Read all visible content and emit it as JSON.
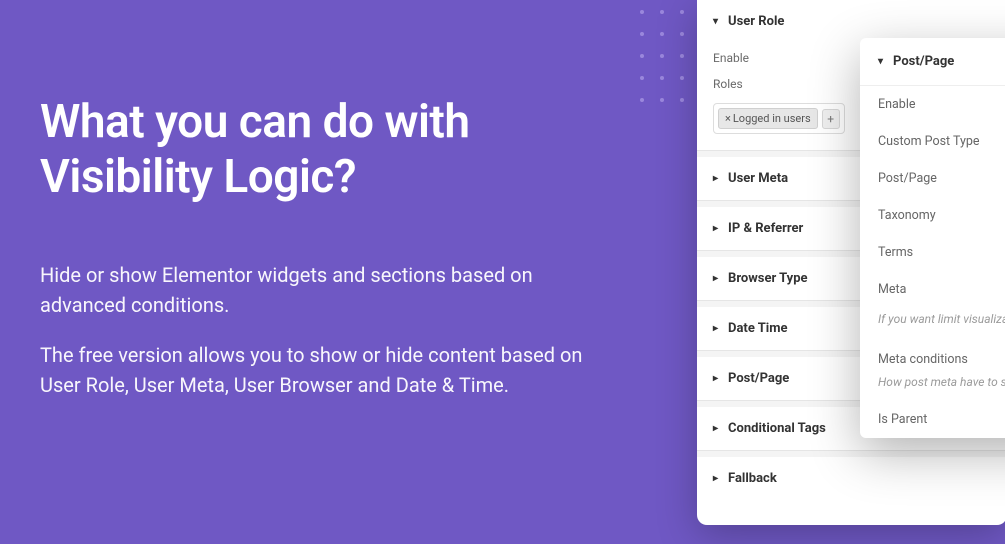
{
  "hero": {
    "headline": "What you can do with Visibility Logic?",
    "para1": "Hide or show Elementor widgets and sections based on advanced conditions.",
    "para2": "The free version allows you to show or hide content based on User Role, User Meta, User Browser and Date & Time."
  },
  "panelBack": {
    "sections": {
      "userRole": {
        "title": "User Role",
        "enableLabel": "Enable",
        "rolesLabel": "Roles",
        "tag": "Logged in users"
      },
      "userMeta": {
        "title": "User Meta"
      },
      "ipReferrer": {
        "title": "IP & Referrer"
      },
      "browserType": {
        "title": "Browser Type"
      },
      "dateTime": {
        "title": "Date Time"
      },
      "postPage": {
        "title": "Post/Page"
      },
      "conditionalTags": {
        "title": "Conditional Tags"
      },
      "fallback": {
        "title": "Fallback"
      }
    }
  },
  "panelFront": {
    "title": "Post/Page",
    "rows": {
      "enable": "Enable",
      "customPostType": "Custom Post Type",
      "postPage": "Post/Page",
      "taxonomy": "Taxonomy",
      "terms": "Terms",
      "meta": "Meta"
    },
    "metaNote": "If you want limit visualization value.",
    "metaConditions": "Meta conditions",
    "metaConditionsNote": "How post meta have to sa",
    "isParent": "Is Parent"
  }
}
